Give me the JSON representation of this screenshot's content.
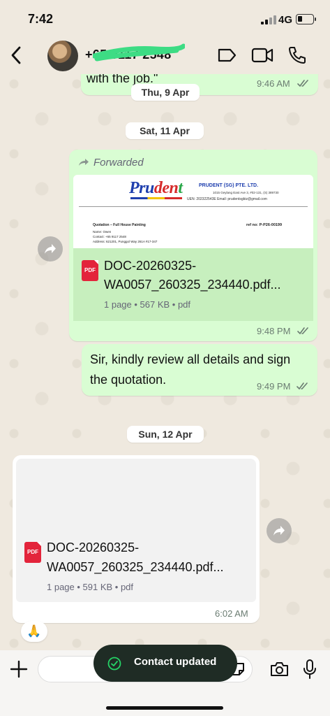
{
  "status_bar": {
    "time": "7:42",
    "network": "4G"
  },
  "header": {
    "contact_name": "+65 9117 2548"
  },
  "messages": {
    "first": {
      "text": "with the job.\"",
      "time": "9:46 AM"
    },
    "date1": "Thu, 9 Apr",
    "date2": "Sat, 11 Apr",
    "doc1": {
      "forwarded_label": "Forwarded",
      "preview": {
        "logo": [
          "Pru",
          "den",
          "t"
        ],
        "company": "PRUDENT (SG) PTE. LTD.",
        "address": "1015 Geylang East Ave 3, #02-131, (S) 389730",
        "uen": "UEN: 202322543E Email: prudentsgbiz@gmail.com",
        "quotation": "Quotation – Full House Painting",
        "ref": "ref no: P-P26-00199",
        "name": "Name: Owen",
        "contact": "Contact: +65 9117 2548",
        "address_line": "Address: 621201, Punggol Way 261A #17-347"
      },
      "pdf_badge": "PDF",
      "filename_line1": "DOC-20260325-",
      "filename_line2": "WA0057_260325_234440.pdf...",
      "meta": "1 page • 567 KB • pdf",
      "time": "9:48 PM"
    },
    "text2": {
      "line1": "Sir, kindly review all details and sign",
      "line2": "the quotation.",
      "time": "9:49 PM"
    },
    "date3": "Sun, 12 Apr",
    "doc2": {
      "pdf_badge": "PDF",
      "filename_line1": "DOC-20260325-",
      "filename_line2": "WA0057_260325_234440.pdf...",
      "meta": "1 page • 591 KB • pdf",
      "time": "6:02 AM"
    },
    "reaction": "🙏"
  },
  "composer": {
    "placeholder": "",
    "value": ""
  },
  "toast": {
    "text": "Contact updated"
  },
  "colors": {
    "outgoing": "#d9fdd3",
    "incoming": "#ffffff",
    "tick": "#6b7c72",
    "toast_bg": "#1f2c25",
    "toast_check": "#25d366",
    "pdf": "#e3243b"
  }
}
